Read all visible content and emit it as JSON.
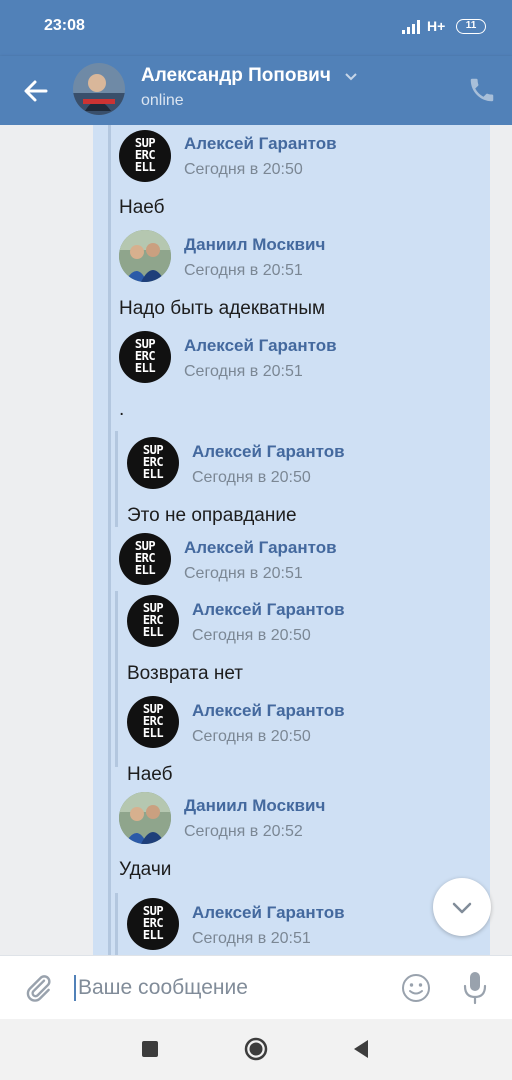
{
  "status_bar": {
    "time": "23:08",
    "network": "H+",
    "battery": "11"
  },
  "header": {
    "name": "Александр Попович",
    "status": "online"
  },
  "messages": [
    {
      "sender": "Алексей Гарантов",
      "time": "Сегодня в 20:50",
      "text": "Наеб",
      "avatar": "supercell-logo"
    },
    {
      "sender": "Даниил Москвич",
      "time": "Сегодня в 20:51",
      "text": "Надо быть адекватным",
      "avatar": "photo"
    },
    {
      "sender": "Алексей Гарантов",
      "time": "Сегодня в 20:51",
      "text": ".",
      "avatar": "supercell-logo"
    },
    {
      "sender": "Алексей Гарантов",
      "time": "Сегодня в 20:50",
      "text": "Это не оправдание",
      "avatar": "supercell-logo",
      "forwarded": true
    },
    {
      "sender": "Алексей Гарантов",
      "time": "Сегодня в 20:51",
      "text": "",
      "avatar": "supercell-logo"
    },
    {
      "sender": "Алексей Гарантов",
      "time": "Сегодня в 20:50",
      "text": "Возврата нет",
      "avatar": "supercell-logo",
      "forwarded": true
    },
    {
      "sender": "Алексей Гарантов",
      "time": "Сегодня в 20:50",
      "text": "Наеб",
      "avatar": "supercell-logo",
      "forwarded": true
    },
    {
      "sender": "Даниил Москвич",
      "time": "Сегодня в 20:52",
      "text": "Удачи",
      "avatar": "photo"
    },
    {
      "sender": "Алексей Гарантов",
      "time": "Сегодня в 20:51",
      "text": "",
      "avatar": "supercell-logo",
      "forwarded": true
    }
  ],
  "supercell_logo": [
    "SUP",
    "ERC",
    "ELL"
  ],
  "composer": {
    "placeholder": "Ваше сообщение"
  },
  "colors": {
    "header": "#5181b8",
    "bubble": "#cfe0f4",
    "sender": "#44699e",
    "time": "#7b8794"
  }
}
